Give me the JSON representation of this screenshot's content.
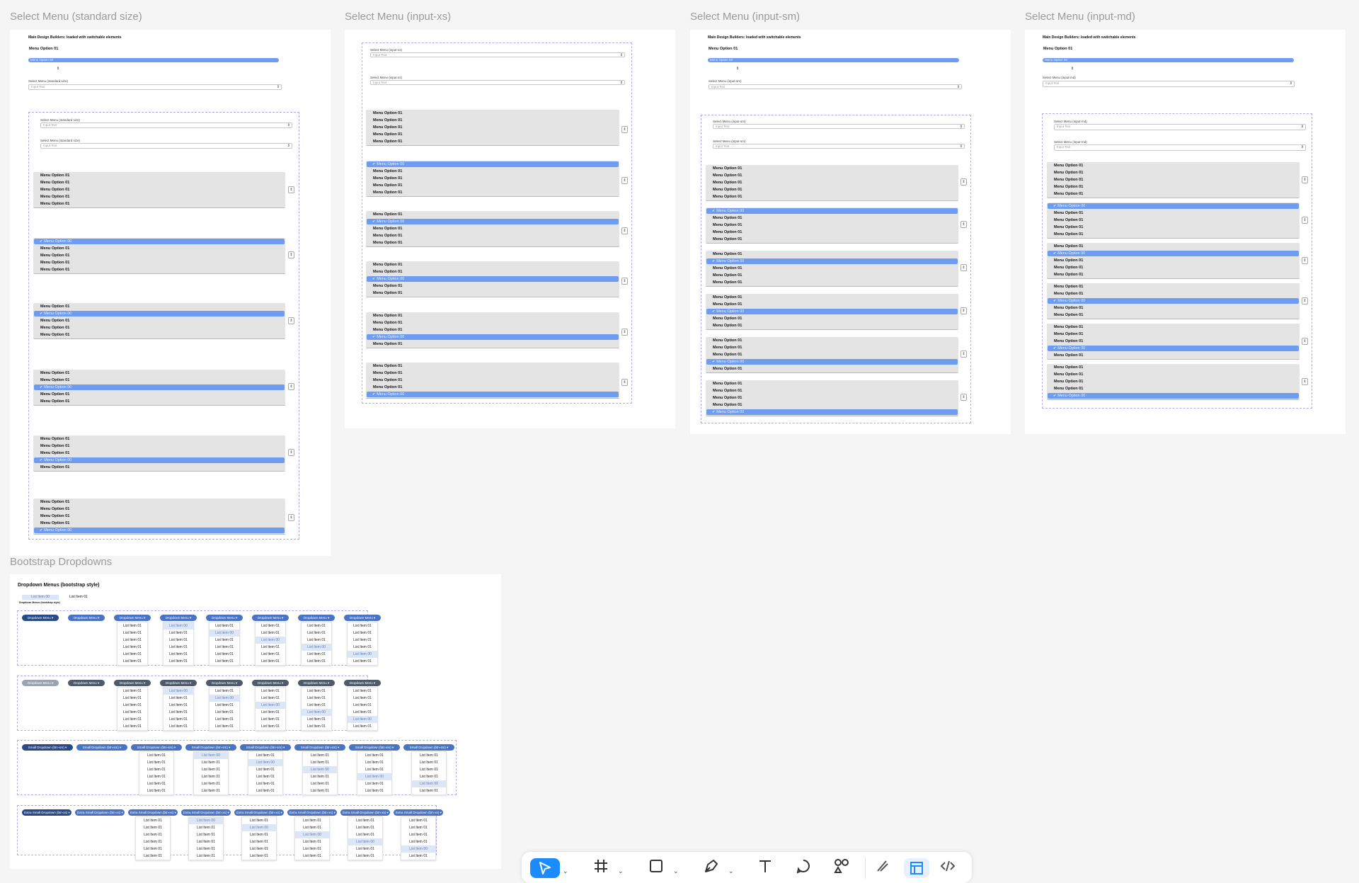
{
  "frames": {
    "standard": "Select Menu (standard size)",
    "xs": "Select Menu (input-xs)",
    "sm": "Select Menu (input-sm)",
    "md": "Select Menu (input-md)",
    "bootstrap": "Bootstrap Dropdowns"
  },
  "select": {
    "builder_title": "Main Design Builders: loaded with switchable elements",
    "menu_option_01": "Menu Option 01",
    "menu_option_00": "Menu Option 00",
    "label_standard": "Select Menu (standard size)",
    "label_xs": "Select Menu (input-xs)",
    "label_sm": "Select Menu (input-sm)",
    "label_md": "Select Menu (input-md)",
    "input_placeholder": "Input Text",
    "arrow": "⇕",
    "stepper": "⇕",
    "small_stepper": "⇕"
  },
  "bootstrap": {
    "title": "Dropdown Menus (bootstrap style)",
    "sample_item_00": "List Item 00",
    "sample_item_01": "List Item 01",
    "sample_caption": "Dropdown Menus (bootstrap style)",
    "btn": "Dropdown Menu ▾",
    "btn_sm": "Small Dropdown (btn-sm) ▾",
    "btn_xs": "Extra Small Dropdown (btn-xs) ▾",
    "item_01": "List Item 01",
    "item_00": "List Item 00"
  },
  "colors": {
    "selected_blue": "#6e9cf0",
    "dark_blue": "#2a4a86",
    "mid_blue": "#4a73c4",
    "grey_btn": "#9aa3b0",
    "slate": "#4f5a6b",
    "dashed_border": "#b7a8ef"
  },
  "toolbar": {
    "move_tool": "move-tool-icon",
    "frame_tool": "frame-tool-icon",
    "rect_tool": "rectangle-tool-icon",
    "pen_tool": "pen-tool-icon",
    "text_tool": "text-tool-icon",
    "comment_tool": "comment-tool-icon",
    "actions": "actions-icon",
    "draw_mode": "draw-mode-icon",
    "design_mode": "design-mode-icon",
    "dev_mode": "dev-mode-icon",
    "caret": "⌄"
  }
}
